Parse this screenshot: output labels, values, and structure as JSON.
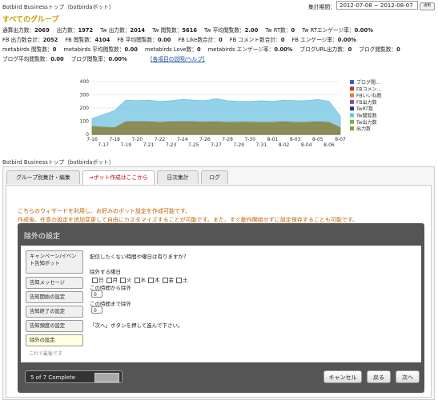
{
  "topbar": {
    "app_title": "Botbird Businessトップ（botbirdaボット）",
    "period_label": "集計期間：",
    "period_value": "2012-07-08 ~ 2012-08-07",
    "apply_label": "適用"
  },
  "group_title": "すべてのグループ",
  "stats_row1": [
    {
      "label": "通算出力数：",
      "value": "2069"
    },
    {
      "label": "出力数：",
      "value": "1972"
    },
    {
      "label": "Tw 出力数：",
      "value": "2014"
    },
    {
      "label": "Tw 閲覧数：",
      "value": "5616"
    },
    {
      "label": "Tw 平均閲覧数：",
      "value": "2.00"
    },
    {
      "label": "Tw RT数：",
      "value": "0"
    },
    {
      "label": "Tw RTエンゲージ率：",
      "value": "0.00%"
    }
  ],
  "stats_row2": [
    {
      "label": "FB 出力数合計：",
      "value": "2052"
    },
    {
      "label": "FB 閲覧数：",
      "value": "4104"
    },
    {
      "label": "FB 平均閲覧数：",
      "value": "0.00"
    },
    {
      "label": "FB Like数合計：",
      "value": "0"
    },
    {
      "label": "FB コメント数合計：",
      "value": "0"
    },
    {
      "label": "FB エンゲージ率：",
      "value": "0.00%"
    }
  ],
  "stats_row3": [
    {
      "label": "metabirds 閲覧数：",
      "value": "0"
    },
    {
      "label": "metabirds 平均閲覧数：",
      "value": "0.00"
    },
    {
      "label": "metabirds Love数：",
      "value": "0"
    },
    {
      "label": "metabirds エンゲージ率：",
      "value": "0.00%"
    },
    {
      "label": "ブログURL出力数：",
      "value": "0"
    },
    {
      "label": "ブログ閲覧数：",
      "value": "0"
    }
  ],
  "stats_row4": [
    {
      "label": "ブログ平均閲覧数：",
      "value": "0.00"
    },
    {
      "label": "ブログ閲覧率：",
      "value": "0.00%"
    }
  ],
  "help_link": "[各項目の説明/ヘルプ]",
  "chart_data": {
    "type": "area",
    "x": [
      "7-16",
      "7-17",
      "7-18",
      "7-19",
      "7-20",
      "7-21",
      "7-22",
      "7-23",
      "7-24",
      "7-25",
      "7-26",
      "7-27",
      "7-28",
      "7-29",
      "7-30",
      "7-31",
      "8-01",
      "8-02",
      "8-03",
      "8-04",
      "8-05",
      "8-06",
      "8-07"
    ],
    "ylim": [
      0,
      400
    ],
    "yticks": [
      0,
      100,
      200,
      300,
      400
    ],
    "series": [
      {
        "name": "ブログ閲...",
        "color": "#3a5fcd",
        "values": [
          0,
          0,
          0,
          0,
          0,
          0,
          0,
          0,
          0,
          0,
          0,
          0,
          0,
          0,
          0,
          0,
          0,
          0,
          0,
          0,
          0,
          0,
          0
        ]
      },
      {
        "name": "FBコメン...",
        "color": "#c0392b",
        "values": [
          0,
          0,
          0,
          0,
          0,
          0,
          0,
          0,
          0,
          0,
          0,
          0,
          0,
          0,
          0,
          0,
          0,
          0,
          0,
          0,
          0,
          0,
          0
        ]
      },
      {
        "name": "FBいいね数",
        "color": "#e67e22",
        "values": [
          0,
          0,
          0,
          0,
          0,
          0,
          0,
          0,
          0,
          0,
          0,
          0,
          0,
          0,
          0,
          0,
          0,
          0,
          0,
          0,
          0,
          0,
          0
        ]
      },
      {
        "name": "FB出力数",
        "color": "#8e44ad",
        "values": [
          60,
          55,
          50,
          95,
          95,
          95,
          90,
          95,
          95,
          95,
          92,
          95,
          90,
          92,
          92,
          90,
          90,
          95,
          90,
          90,
          95,
          90,
          50
        ]
      },
      {
        "name": "TwRT数",
        "color": "#1f3a93",
        "values": [
          0,
          0,
          0,
          0,
          0,
          0,
          0,
          0,
          0,
          0,
          0,
          0,
          0,
          0,
          0,
          0,
          0,
          0,
          0,
          0,
          0,
          0,
          0
        ]
      },
      {
        "name": "Tw閲覧数",
        "color": "#6fc3e0",
        "values": [
          120,
          150,
          180,
          260,
          255,
          260,
          250,
          255,
          265,
          260,
          255,
          270,
          255,
          250,
          250,
          255,
          250,
          260,
          255,
          255,
          265,
          250,
          140
        ]
      },
      {
        "name": "Tw出力数",
        "color": "#66bb3a",
        "values": [
          60,
          55,
          50,
          95,
          95,
          95,
          90,
          95,
          95,
          95,
          92,
          95,
          90,
          92,
          92,
          90,
          90,
          95,
          90,
          90,
          95,
          90,
          50
        ]
      },
      {
        "name": "出力数",
        "color": "#8e9a3e",
        "values": [
          60,
          55,
          50,
          92,
          92,
          92,
          88,
          92,
          92,
          92,
          90,
          92,
          88,
          90,
          90,
          88,
          88,
          92,
          88,
          88,
          92,
          88,
          48
        ]
      }
    ]
  },
  "app2_title": "Botbird Businessトップ（botbirdaボット）",
  "tabs": [
    {
      "label": "グループ別集計・編集"
    },
    {
      "label": "⇒ボット作成はここから"
    },
    {
      "label": "日次集計"
    },
    {
      "label": "ログ"
    }
  ],
  "intro_line1": "こちらのウィザードを利用し、お好みのボット設定を作成可能です。",
  "intro_line2": "作成後、任意の設定を追加変更して自由にカスタマイズすることが可能です。また、すぐ動作開始せずに設定保存することも可能です。",
  "wizard": {
    "title": "除外の設定",
    "steps": [
      {
        "label": "キャンペーン/イベント告知ボット"
      },
      {
        "label": "告知メッセージ"
      },
      {
        "label": "告知開始の設定"
      },
      {
        "label": "告知終了の設定"
      },
      {
        "label": "告知頻度の設定"
      },
      {
        "label": "除外の設定"
      }
    ],
    "last_step_note": "これで最後です",
    "question": "配信したくない時間や曜日は有りますか？",
    "exclude_days_label": "除外する曜日",
    "days": [
      "日",
      "月",
      "火",
      "水",
      "木",
      "金",
      "土"
    ],
    "from_label": "この時間から除外",
    "from_value": "0",
    "to_label": "この時間まで除外",
    "to_value": "0",
    "hint": "「次へ」ボタンを押して進んで下さい。",
    "progress_text": "5 of 7 Complete",
    "progress_fraction": 0.714,
    "cancel_label": "キャンセル",
    "back_label": "戻る",
    "next_label": "次へ"
  }
}
